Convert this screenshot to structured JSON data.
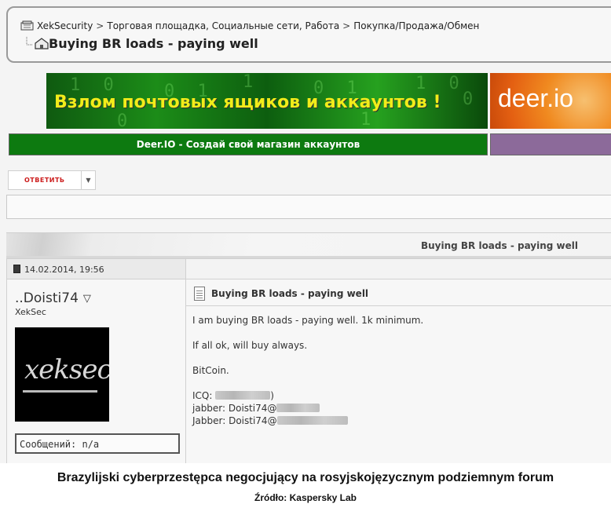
{
  "breadcrumb": {
    "items": [
      "XekSecurity",
      "Торговая площадка, Социальные сети, Работа",
      "Покупка/Продажа/Обмен"
    ],
    "separator": ">",
    "thread_title": "Buying BR loads - paying well"
  },
  "banners": {
    "main_text": "Взлом почтовых ящиков и аккаунтов !",
    "side_text": "deer.io",
    "bar_text": "Deer.IO - Создай свой магазин аккаунтов"
  },
  "toolbar": {
    "reply_label": "ОТВЕТИТЬ",
    "dropdown_glyph": "▼"
  },
  "post": {
    "header_title": "Buying BR loads - paying well",
    "date": "14.02.2014, 19:56",
    "author": {
      "name": "..Doisti74",
      "title": "XekSec",
      "avatar_text": "xeksec",
      "posts_label": "Сообщений: n/a"
    },
    "message": {
      "title": "Buying BR loads - paying well",
      "line1": "I am buying BR loads - paying well. 1k minimum.",
      "line2": "If all ok, will buy always.",
      "line3": "BitCoin.",
      "icq_label": "ICQ:",
      "icq_close": ")",
      "jabber1_label": "jabber: Doisti74@",
      "jabber2_label": "Jabber: Doisti74@"
    }
  },
  "caption": {
    "title": "Brazylijski cyberprzestępca negocjujący na rosyjskojęzycznym podziemnym forum",
    "source": "Źródło: Kaspersky Lab"
  },
  "colors": {
    "banner_green": "#0d7a10",
    "banner_text_yellow": "#f2ec1a",
    "deer_orange": "#f08a20",
    "purple_bar": "#8c6a9a",
    "reply_red": "#cc1c1c"
  }
}
